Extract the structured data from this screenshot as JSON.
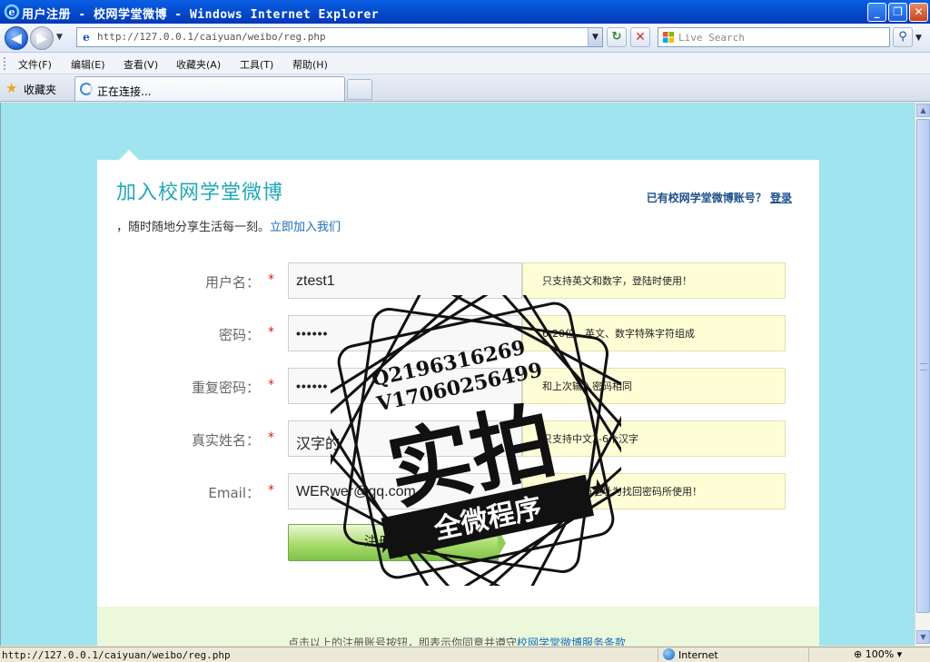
{
  "window": {
    "title": "用户注册 - 校网学堂微博 - Windows Internet Explorer",
    "minimize": "_",
    "maximize": "❐",
    "close": "✕"
  },
  "nav": {
    "url": "http://127.0.0.1/caiyuan/weibo/reg.php",
    "search_placeholder": "Live Search"
  },
  "menu": [
    "文件(F)",
    "编辑(E)",
    "查看(V)",
    "收藏夹(A)",
    "工具(T)",
    "帮助(H)"
  ],
  "favorites_label": "收藏夹",
  "tab": {
    "label": "正在连接..."
  },
  "page": {
    "heading": "加入校网学堂微博",
    "subline_text": "，随时随地分享生活每一刻。",
    "subline_link": "立即加入我们",
    "login_hint": "已有校网学堂微博账号？",
    "login_link": "登录",
    "required_mark": "*",
    "fields": [
      {
        "label": "用户名：",
        "value": "ztest1",
        "hint": "只支持英文和数字，登陆时使用！"
      },
      {
        "label": "密码：",
        "value": "••••••",
        "hint": "6-20位，英文、数字特殊字符组成"
      },
      {
        "label": "重复密码：",
        "value": "••••••",
        "hint": "和上次输入密码相同"
      },
      {
        "label": "真实姓名：",
        "value": "汉字的",
        "hint": "只支持中文2-6个汉字"
      },
      {
        "label": "Email：",
        "value": "WERwer@qq.com",
        "hint": "重要：邮箱地址为找回密码所使用！"
      }
    ],
    "submit_label": "注册账号",
    "terms_text": "点击以上的注册账号按钮，即表示你同意并遵守",
    "terms_link": "校网学堂微博服务条款"
  },
  "watermark": {
    "line1": "Q2196316269",
    "line2": "V17060256499",
    "big": "实拍",
    "banner": "全微程序"
  },
  "status": {
    "url": "http://127.0.0.1/caiyuan/weibo/reg.php",
    "zone": "Internet",
    "zoom": "100%"
  },
  "colors": {
    "page_bg": "#9fe4ee",
    "heading": "#23a8b8",
    "hint_bg": "#fefed6",
    "button_green": "#a9dc6c"
  }
}
